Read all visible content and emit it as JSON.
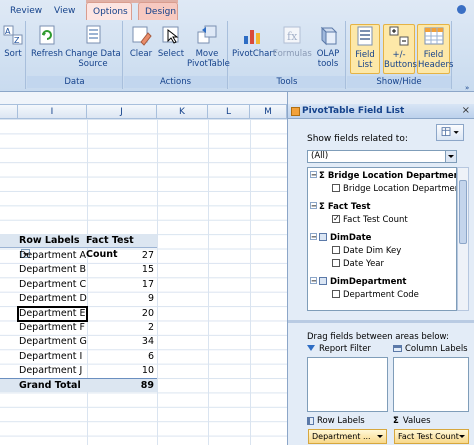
{
  "ribbon": {
    "tabs": [
      "Review",
      "View",
      "Options",
      "Design"
    ],
    "groups": {
      "data": "Data",
      "actions": "Actions",
      "tools": "Tools",
      "showhide": "Show/Hide"
    },
    "buttons": {
      "sort": "Sort",
      "refresh": "Refresh",
      "change_source_1": "Change Data",
      "change_source_2": "Source",
      "clear": "Clear",
      "select": "Select",
      "move_1": "Move",
      "move_2": "PivotTable",
      "pivotchart": "PivotChart",
      "formulas": "Formulas",
      "olap_1": "OLAP",
      "olap_2": "tools",
      "field_list_1": "Field",
      "field_list_2": "List",
      "buttons_1": "+/-",
      "buttons_2": "Buttons",
      "headers_1": "Field",
      "headers_2": "Headers"
    }
  },
  "sheet": {
    "columns": [
      "I",
      "J",
      "K",
      "L",
      "M"
    ],
    "pivot": {
      "row_labels_header": "Row Labels",
      "value_header": "Fact Test Count",
      "rows": [
        {
          "label": "Department A",
          "value": "27"
        },
        {
          "label": "Department B",
          "value": "15"
        },
        {
          "label": "Department C",
          "value": "17"
        },
        {
          "label": "Department D",
          "value": "9"
        },
        {
          "label": "Department E",
          "value": "20"
        },
        {
          "label": "Department F",
          "value": "2"
        },
        {
          "label": "Department G",
          "value": "34"
        },
        {
          "label": "Department I",
          "value": "6"
        },
        {
          "label": "Department J",
          "value": "10"
        }
      ],
      "total_label": "Grand Total",
      "total_value": "89"
    }
  },
  "pane": {
    "title": "PivotTable Field List",
    "show_fields_label": "Show fields related to:",
    "filter_value": "(All)",
    "fields": [
      {
        "text": "Bridge Location Department",
        "kind": "measure-group"
      },
      {
        "text": "Bridge Location Department C...",
        "kind": "field",
        "checked": false
      },
      {
        "text": "Fact Test",
        "kind": "measure-group"
      },
      {
        "text": "Fact Test Count",
        "kind": "field",
        "checked": true
      },
      {
        "text": "DimDate",
        "kind": "dimension"
      },
      {
        "text": "Date Dim Key",
        "kind": "field",
        "checked": false
      },
      {
        "text": "Date Year",
        "kind": "field",
        "checked": false
      },
      {
        "text": "DimDepartment",
        "kind": "dimension"
      },
      {
        "text": "Department Code",
        "kind": "field",
        "checked": false
      }
    ],
    "drag_label": "Drag fields between areas below:",
    "areas": {
      "report_filter": "Report Filter",
      "column_labels": "Column Labels",
      "row_labels": "Row Labels",
      "values": "Values"
    },
    "chips": {
      "row": "Department ...",
      "values": "Fact Test Count"
    }
  }
}
